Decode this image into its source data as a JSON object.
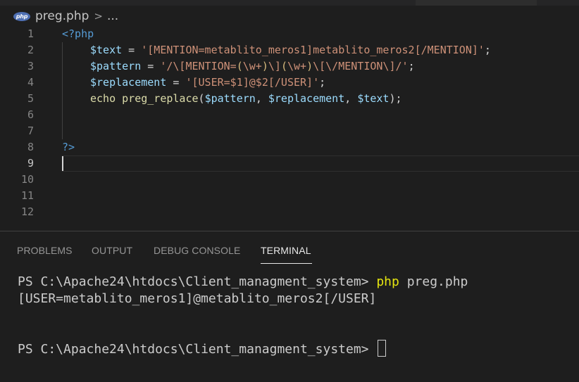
{
  "breadcrumb": {
    "icon_label": "php",
    "file": "preg.php",
    "separator": ">",
    "more": "..."
  },
  "editor": {
    "line_numbers": [
      "1",
      "2",
      "3",
      "4",
      "5",
      "6",
      "7",
      "8",
      "9",
      "10",
      "11",
      "12"
    ],
    "active_line": 9,
    "lines": {
      "l1": {
        "open_tag": "<?php"
      },
      "l2": {
        "var": "$text",
        "eq": " = ",
        "str": "'[MENTION=metablito_meros1]metablito_meros2[/MENTION]'",
        "end": ";"
      },
      "l3": {
        "var": "$pattern",
        "eq": " = ",
        "s1": "'/\\[MENTION=",
        "s2": "(",
        "s3": "\\w+",
        "s4": ")",
        "s5": "\\]",
        "s6": "(",
        "s7": "\\w+",
        "s8": ")",
        "s9": "\\[\\/MENTION\\]",
        "s10": "/'",
        "end": ";"
      },
      "l4": {
        "var": "$replacement",
        "eq": " = ",
        "str": "'[USER=$1]@$2[/USER]'",
        "end": ";"
      },
      "l5": {
        "kw": "echo",
        "sp": " ",
        "fn": "preg_replace",
        "p1": "(",
        "a1": "$pattern",
        "c1": ", ",
        "a2": "$replacement",
        "c2": ", ",
        "a3": "$text",
        "p2": ");"
      },
      "l8": {
        "close_tag": "?>"
      }
    }
  },
  "panel": {
    "tabs": [
      "PROBLEMS",
      "OUTPUT",
      "DEBUG CONSOLE",
      "TERMINAL"
    ],
    "active_tab": "TERMINAL",
    "terminal": {
      "prompt1": "PS C:\\Apache24\\htdocs\\Client_managment_system> ",
      "cmd_word": "php",
      "cmd_arg": " preg.php",
      "output": "[USER=metablito_meros1]@metablito_meros2[/USER]",
      "prompt2": "PS C:\\Apache24\\htdocs\\Client_managment_system> "
    }
  },
  "colors": {
    "background": "#1e1e1e",
    "keyword_blue": "#569cd6",
    "variable": "#9cdcfe",
    "string": "#ce9178",
    "regex_group": "#d7ba7d",
    "terminal_command": "#e5e510"
  },
  "icons": [
    "php-file-icon",
    "chevron-right-icon",
    "text-cursor-icon"
  ]
}
